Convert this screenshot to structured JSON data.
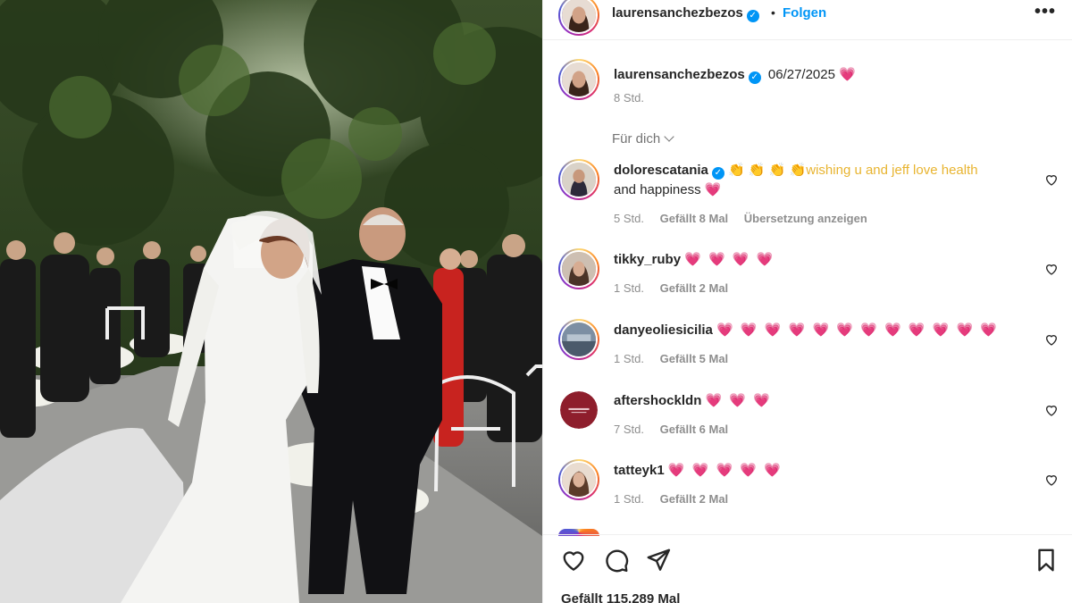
{
  "post": {
    "username": "laurensanchezbezos",
    "follow_label": "Folgen",
    "separator": "•",
    "more_label": "•••"
  },
  "caption": {
    "username": "laurensanchezbezos",
    "text": "06/27/2025",
    "emoji": "💗",
    "time": "8 Std."
  },
  "sort_label": "Für dich",
  "comments": [
    {
      "username": "dolorescatania",
      "verified": true,
      "text_line1": "👏 👏 👏 👏wishing u and jeff love health",
      "text_line2": "and happiness",
      "emoji": "💗",
      "time": "5 Std.",
      "likes": "Gefällt 8 Mal",
      "translate": "Übersetzung anzeigen"
    },
    {
      "username": "tikky_ruby",
      "hearts": "💗 💗 💗 💗",
      "time": "1 Std.",
      "likes": "Gefällt 2 Mal"
    },
    {
      "username": "danyeoliesicilia",
      "hearts": "💗 💗 💗 💗 💗 💗 💗 💗 💗 💗 💗 💗",
      "time": "1 Std.",
      "likes": "Gefällt 5 Mal"
    },
    {
      "username": "aftershockldn",
      "hearts": "💗 💗 💗",
      "time": "7 Std.",
      "likes": "Gefällt 6 Mal"
    },
    {
      "username": "tatteyk1",
      "hearts": "💗 💗 💗 💗 💗",
      "time": "1 Std.",
      "likes": "Gefällt 2 Mal"
    }
  ],
  "likes_total": "Gefällt 115.289 Mal",
  "colors": {
    "accent": "#0095f6",
    "heart": "#ed4956",
    "muted": "#8e8e8e",
    "text": "#262626"
  },
  "icons": [
    "verified-icon",
    "more-icon",
    "chevron-down-icon",
    "heart-icon",
    "comment-icon",
    "share-icon",
    "bookmark-icon"
  ]
}
